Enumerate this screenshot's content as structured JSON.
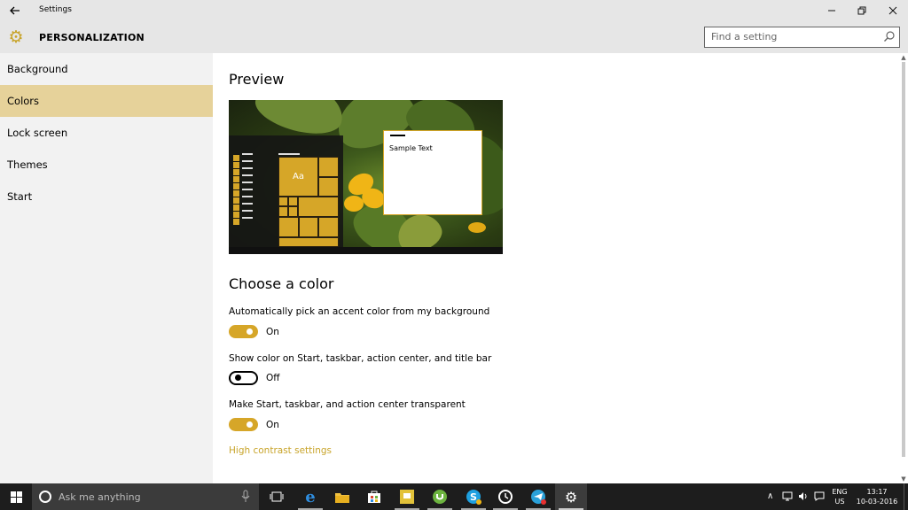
{
  "window": {
    "app_title": "Settings",
    "controls": [
      "minimize-icon",
      "restore-icon",
      "close-icon"
    ]
  },
  "header": {
    "section_title": "PERSONALIZATION",
    "search_placeholder": "Find a setting"
  },
  "sidebar": {
    "items": [
      {
        "label": "Background",
        "active": false
      },
      {
        "label": "Colors",
        "active": true
      },
      {
        "label": "Lock screen",
        "active": false
      },
      {
        "label": "Themes",
        "active": false
      },
      {
        "label": "Start",
        "active": false
      }
    ]
  },
  "main": {
    "preview_heading": "Preview",
    "preview_sample_text": "Sample Text",
    "preview_tile_label": "Aa",
    "choose_heading": "Choose a color",
    "options": [
      {
        "label": "Automatically pick an accent color from my background",
        "state": "On",
        "on": true
      },
      {
        "label": "Show color on Start, taskbar, action center, and title bar",
        "state": "Off",
        "on": false
      },
      {
        "label": "Make Start, taskbar, and action center transparent",
        "state": "On",
        "on": true
      }
    ],
    "link": "High contrast settings"
  },
  "taskbar": {
    "search_placeholder": "Ask me anything",
    "apps": [
      "task-view-icon",
      "edge-icon",
      "file-explorer-icon",
      "store-icon",
      "sticky-notes-icon",
      "utorrent-icon",
      "skype-icon",
      "clock-app-icon",
      "telegram-icon",
      "settings-icon"
    ],
    "tray": {
      "language_line1": "ENG",
      "language_line2": "US",
      "time": "13:17",
      "date": "10-03-2016"
    }
  },
  "colors": {
    "accent": "#d6a628",
    "selected_item": "#e6d29a",
    "link": "#c8a42a"
  }
}
